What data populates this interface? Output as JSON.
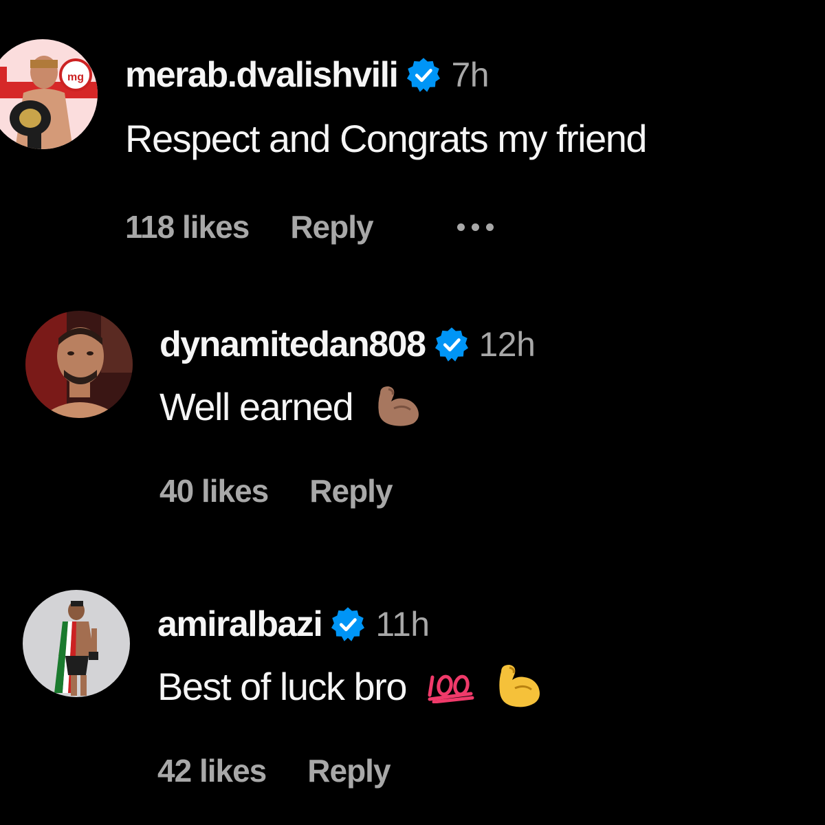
{
  "colors": {
    "background": "#000000",
    "primary_text": "#f5f5f5",
    "secondary_text": "#a8a8a8",
    "verified_badge": "#0095f6"
  },
  "comments": [
    {
      "username": "merab.dvalishvili",
      "verified": true,
      "time": "7h",
      "text": "Respect and Congrats my friend",
      "emojis": [],
      "likes": "118 likes",
      "reply_label": "Reply",
      "has_more_menu": true,
      "avatar_icon": "avatar-merab-dvalishvili"
    },
    {
      "username": "dynamitedan808",
      "verified": true,
      "time": "12h",
      "text": "Well earned",
      "emojis": [
        "flexed-biceps-medium-skin"
      ],
      "likes": "40 likes",
      "reply_label": "Reply",
      "has_more_menu": false,
      "avatar_icon": "avatar-dynamitedan808"
    },
    {
      "username": "amiralbazi",
      "verified": true,
      "time": "11h",
      "text": "Best of luck bro",
      "emojis": [
        "hundred-points",
        "flexed-biceps"
      ],
      "likes": "42 likes",
      "reply_label": "Reply",
      "has_more_menu": false,
      "avatar_icon": "avatar-amiralbazi"
    }
  ]
}
